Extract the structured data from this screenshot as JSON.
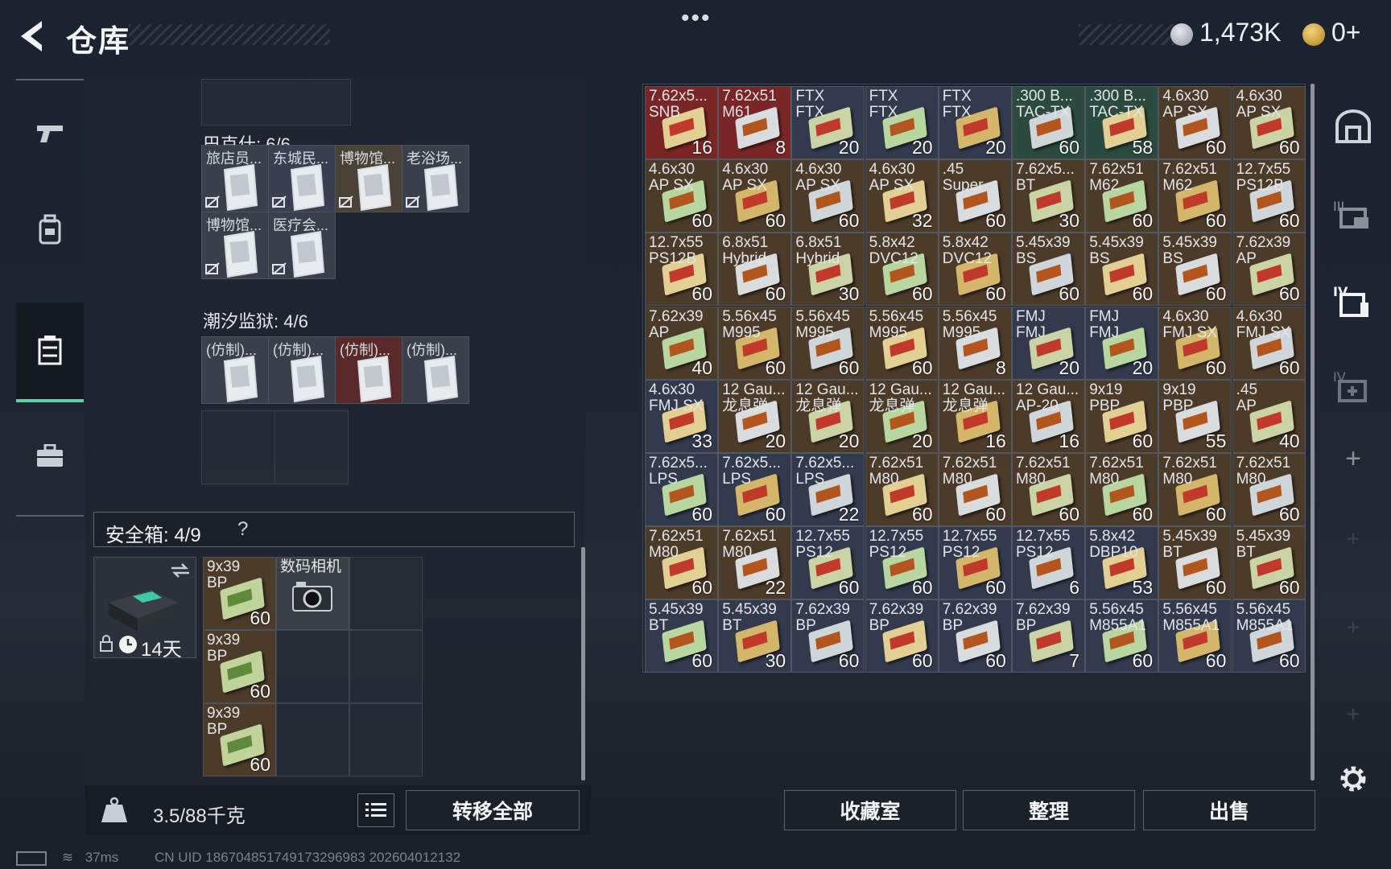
{
  "header": {
    "title": "仓库",
    "coins": "1,473K",
    "gold": "0+"
  },
  "left_panel": {
    "bakeshi": {
      "label": "巴克什: 6/6",
      "items": [
        {
          "name": "旅店员..."
        },
        {
          "name": "东城民..."
        },
        {
          "name": "博物馆..."
        },
        {
          "name": "老浴场..."
        },
        {
          "name": "博物馆..."
        },
        {
          "name": "医疗会..."
        }
      ]
    },
    "chaoxi": {
      "label": "潮汐监狱: 4/6",
      "items": [
        {
          "name": "(仿制)..."
        },
        {
          "name": "(仿制)..."
        },
        {
          "name": "(仿制)..."
        },
        {
          "name": "(仿制)..."
        }
      ]
    },
    "safebox": {
      "label": "安全箱: 4/9",
      "help": "?",
      "timer": "14天",
      "items": [
        {
          "name": "9x39\nBP",
          "count": "60"
        },
        {
          "name": "数码相机",
          "count": ""
        },
        {
          "name": "9x39\nBP",
          "count": "60"
        },
        {
          "name": "9x39\nBP",
          "count": "60"
        }
      ]
    },
    "weight": "3.5/88千克",
    "transfer_label": "转移全部"
  },
  "storage": {
    "cells": [
      {
        "name": "7.62x5...\nSNB",
        "count": "16",
        "color": "#7a2626"
      },
      {
        "name": "7.62x51\nM61",
        "count": "8",
        "color": "#7a2626"
      },
      {
        "name": "FTX\nFTX",
        "count": "20",
        "color": "#333a4d"
      },
      {
        "name": "FTX\nFTX",
        "count": "20",
        "color": "#333a4d"
      },
      {
        "name": "FTX\nFTX",
        "count": "20",
        "color": "#333a4d"
      },
      {
        "name": ".300 B...\nTAC-TX",
        "count": "60",
        "color": "#2c4a3f"
      },
      {
        "name": ".300 B...\nTAC-TX",
        "count": "58",
        "color": "#2c4a3f"
      },
      {
        "name": "4.6x30\nAP SX",
        "count": "60",
        "color": "#4d3b2a"
      },
      {
        "name": "4.6x30\nAP SX",
        "count": "60",
        "color": "#4d3b2a"
      },
      {
        "name": "4.6x30\nAP SX",
        "count": "60",
        "color": "#4d3b2a"
      },
      {
        "name": "4.6x30\nAP SX",
        "count": "60",
        "color": "#4d3b2a"
      },
      {
        "name": "4.6x30\nAP SX",
        "count": "60",
        "color": "#4d3b2a"
      },
      {
        "name": "4.6x30\nAP SX",
        "count": "32",
        "color": "#4d3b2a"
      },
      {
        "name": ".45\nSuper",
        "count": "60",
        "color": "#4d3b2a"
      },
      {
        "name": "7.62x5...\nBT",
        "count": "30",
        "color": "#4d3b2a"
      },
      {
        "name": "7.62x51\nM62",
        "count": "60",
        "color": "#4d3b2a"
      },
      {
        "name": "7.62x51\nM62",
        "count": "60",
        "color": "#4d3b2a"
      },
      {
        "name": "12.7x55\nPS12B",
        "count": "60",
        "color": "#4d3b2a"
      },
      {
        "name": "12.7x55\nPS12B",
        "count": "60",
        "color": "#4d3b2a"
      },
      {
        "name": "6.8x51\nHybrid",
        "count": "60",
        "color": "#4d3b2a"
      },
      {
        "name": "6.8x51\nHybrid",
        "count": "30",
        "color": "#4d3b2a"
      },
      {
        "name": "5.8x42\nDVC12",
        "count": "60",
        "color": "#4d3b2a"
      },
      {
        "name": "5.8x42\nDVC12",
        "count": "60",
        "color": "#4d3b2a"
      },
      {
        "name": "5.45x39\nBS",
        "count": "60",
        "color": "#4d3b2a"
      },
      {
        "name": "5.45x39\nBS",
        "count": "60",
        "color": "#4d3b2a"
      },
      {
        "name": "5.45x39\nBS",
        "count": "60",
        "color": "#4d3b2a"
      },
      {
        "name": "7.62x39\nAP",
        "count": "60",
        "color": "#4d3b2a"
      },
      {
        "name": "7.62x39\nAP",
        "count": "40",
        "color": "#4d3b2a"
      },
      {
        "name": "5.56x45\nM995",
        "count": "60",
        "color": "#4d3b2a"
      },
      {
        "name": "5.56x45\nM995",
        "count": "60",
        "color": "#4d3b2a"
      },
      {
        "name": "5.56x45\nM995",
        "count": "60",
        "color": "#4d3b2a"
      },
      {
        "name": "5.56x45\nM995",
        "count": "8",
        "color": "#4d3b2a"
      },
      {
        "name": "FMJ\nFMJ",
        "count": "20",
        "color": "#333a4d"
      },
      {
        "name": "FMJ\nFMJ",
        "count": "20",
        "color": "#333a4d"
      },
      {
        "name": "4.6x30\nFMJ SX",
        "count": "60",
        "color": "#4d3b2a"
      },
      {
        "name": "4.6x30\nFMJ SX",
        "count": "60",
        "color": "#4d3b2a"
      },
      {
        "name": "4.6x30\nFMJ SX",
        "count": "33",
        "color": "#333a4d"
      },
      {
        "name": "12 Gau...\n龙息弹",
        "count": "20",
        "color": "#4d3b2a"
      },
      {
        "name": "12 Gau...\n龙息弹",
        "count": "20",
        "color": "#4d3b2a"
      },
      {
        "name": "12 Gau...\n龙息弹",
        "count": "20",
        "color": "#4d3b2a"
      },
      {
        "name": "12 Gau...\n龙息弹",
        "count": "16",
        "color": "#4d3b2a"
      },
      {
        "name": "12 Gau...\nAP-20",
        "count": "16",
        "color": "#4d3b2a"
      },
      {
        "name": "9x19\nPBP",
        "count": "60",
        "color": "#4d3b2a"
      },
      {
        "name": "9x19\nPBP",
        "count": "55",
        "color": "#4d3b2a"
      },
      {
        "name": ".45\nAP",
        "count": "40",
        "color": "#4d3b2a"
      },
      {
        "name": "7.62x5...\nLPS",
        "count": "60",
        "color": "#333a4d"
      },
      {
        "name": "7.62x5...\nLPS",
        "count": "60",
        "color": "#333a4d"
      },
      {
        "name": "7.62x5...\nLPS",
        "count": "22",
        "color": "#333a4d"
      },
      {
        "name": "7.62x51\nM80",
        "count": "60",
        "color": "#4d3b2a"
      },
      {
        "name": "7.62x51\nM80",
        "count": "60",
        "color": "#4d3b2a"
      },
      {
        "name": "7.62x51\nM80",
        "count": "60",
        "color": "#4d3b2a"
      },
      {
        "name": "7.62x51\nM80",
        "count": "60",
        "color": "#4d3b2a"
      },
      {
        "name": "7.62x51\nM80",
        "count": "60",
        "color": "#4d3b2a"
      },
      {
        "name": "7.62x51\nM80",
        "count": "60",
        "color": "#4d3b2a"
      },
      {
        "name": "7.62x51\nM80",
        "count": "60",
        "color": "#4d3b2a"
      },
      {
        "name": "7.62x51\nM80",
        "count": "22",
        "color": "#4d3b2a"
      },
      {
        "name": "12.7x55\nPS12",
        "count": "60",
        "color": "#333a4d"
      },
      {
        "name": "12.7x55\nPS12",
        "count": "60",
        "color": "#333a4d"
      },
      {
        "name": "12.7x55\nPS12",
        "count": "60",
        "color": "#333a4d"
      },
      {
        "name": "12.7x55\nPS12",
        "count": "6",
        "color": "#333a4d"
      },
      {
        "name": "5.8x42\nDBP10",
        "count": "53",
        "color": "#333a4d"
      },
      {
        "name": "5.45x39\nBT",
        "count": "60",
        "color": "#4d3b2a"
      },
      {
        "name": "5.45x39\nBT",
        "count": "60",
        "color": "#4d3b2a"
      },
      {
        "name": "5.45x39\nBT",
        "count": "60",
        "color": "#333a4d"
      },
      {
        "name": "5.45x39\nBT",
        "count": "30",
        "color": "#333a4d"
      },
      {
        "name": "7.62x39\nBP",
        "count": "60",
        "color": "#333a4d"
      },
      {
        "name": "7.62x39\nBP",
        "count": "60",
        "color": "#333a4d"
      },
      {
        "name": "7.62x39\nBP",
        "count": "60",
        "color": "#333a4d"
      },
      {
        "name": "7.62x39\nBP",
        "count": "7",
        "color": "#333a4d"
      },
      {
        "name": "5.56x45\nM855A1",
        "count": "60",
        "color": "#333a4d"
      },
      {
        "name": "5.56x45\nM855A1",
        "count": "60",
        "color": "#333a4d"
      },
      {
        "name": "5.56x45\nM855A1",
        "count": "60",
        "color": "#333a4d"
      }
    ]
  },
  "buttons": {
    "collection": "收藏室",
    "sort": "整理",
    "sell": "出售"
  },
  "status": {
    "ping": "37ms",
    "uid": "CN UID 186704851749173296983 202604012132"
  }
}
